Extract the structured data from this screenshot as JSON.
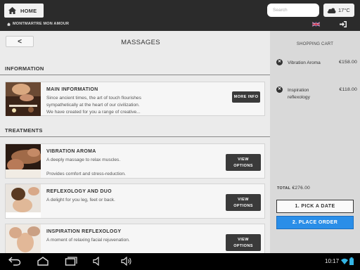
{
  "header": {
    "home_label": "HOME",
    "search_placeholder": "Search",
    "temperature": "17°C",
    "breadcrumb": "MONTMARTRE MON AMOUR",
    "language": "English (UK flag)"
  },
  "main": {
    "back_label": "<",
    "title": "MASSAGES",
    "information_heading": "INFORMATION",
    "treatments_heading": "TREATMENTS",
    "info_card": {
      "title": "MAIN INFORMATION",
      "line1": "Since ancient times, the art of touch flourishes",
      "line2": "sympathetically at the heart of our civilization.",
      "line3": "We have created for you a range of creative...",
      "button": "MORE INFO"
    },
    "treatments": [
      {
        "title": "VIBRATION AROMA",
        "line1": "A deeply massage to relax muscles.",
        "line2": "",
        "line3": "Provides comfort and stress-reduction.",
        "button_line1": "VIEW",
        "button_line2": "OPTIONS"
      },
      {
        "title": "REFLEXOLOGY AND DUO",
        "line1": "A delight for you leg, feet or back.",
        "line2": "",
        "line3": "",
        "button_line1": "VIEW",
        "button_line2": "OPTIONS"
      },
      {
        "title": "INSPIRATION REFLEXOLOGY",
        "line1": "A moment of relaxing facial rejuvenation.",
        "line2": "",
        "line3": "",
        "button_line1": "VIEW",
        "button_line2": "OPTIONS"
      }
    ]
  },
  "cart": {
    "title": "SHOPPING CART",
    "items": [
      {
        "name": "Vibration Aroma",
        "price": "€158.00"
      },
      {
        "name": "Inspiration reflexology",
        "price": "€118.00"
      }
    ],
    "total_label": "TOTAL",
    "total_value": "€276.00",
    "pick_date": "1. PICK A DATE",
    "place_order": "2. PLACE ORDER"
  },
  "system": {
    "clock": "10:17"
  },
  "colors": {
    "accent": "#2a8ee8",
    "topbar": "#2b2b2b",
    "button_dark": "#3a3a3a"
  }
}
